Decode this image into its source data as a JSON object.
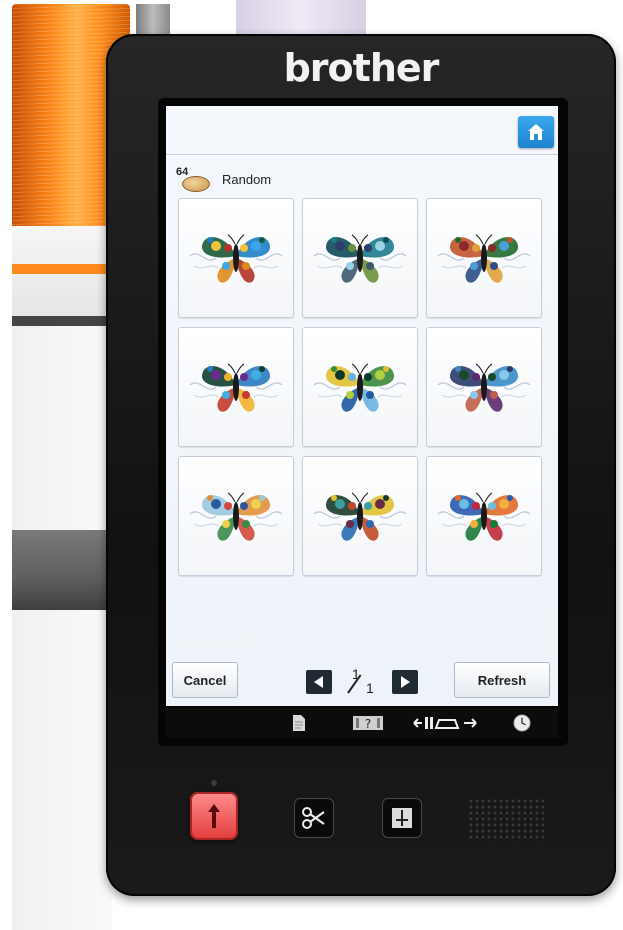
{
  "device": {
    "brand": "brother"
  },
  "screen": {
    "header": {
      "home_button_icon": "home-icon"
    },
    "pattern_count": "64",
    "mode_label": "Random",
    "thumbnails": [
      {
        "label": "",
        "palette": [
          "#1a5a3a",
          "#1e7fc4",
          "#e08a1c",
          "#b0322a",
          "#f2c23a",
          "#3aa7ec"
        ]
      },
      {
        "label": "",
        "palette": [
          "#0e4a5a",
          "#1b7a8a",
          "#3c5a6a",
          "#6b8f3a",
          "#2b3f6a",
          "#9bd2e6"
        ]
      },
      {
        "label": "",
        "palette": [
          "#c0542a",
          "#1f6a2f",
          "#2b4f8a",
          "#e0a03a",
          "#8a2a2a",
          "#4aa0d6"
        ]
      },
      {
        "label": "",
        "palette": [
          "#0f3f2f",
          "#2a7ac0",
          "#c23a2a",
          "#f0b030",
          "#6b2a8a",
          "#3cb0e0"
        ]
      },
      {
        "label": "",
        "palette": [
          "#e0c030",
          "#3a8a3a",
          "#1e5aa0",
          "#6ab0e0",
          "#0a3a2a",
          "#b0d040"
        ]
      },
      {
        "label": "",
        "palette": [
          "#2a3a6a",
          "#3a8ac8",
          "#c0604a",
          "#5a2a6a",
          "#1a4a2a",
          "#8ac8e8"
        ]
      },
      {
        "label": "",
        "palette": [
          "#9ac8e0",
          "#e0903a",
          "#3a8a4a",
          "#d04a3a",
          "#2a5a9a",
          "#f0d050"
        ]
      },
      {
        "label": "",
        "palette": [
          "#1a3a2a",
          "#e0c030",
          "#2a6ab0",
          "#c04a2a",
          "#3aa0a0",
          "#6a2a4a"
        ]
      },
      {
        "label": "",
        "palette": [
          "#2a5ab0",
          "#e06a2a",
          "#1a7a3a",
          "#c02a3a",
          "#6ac0e0",
          "#f0b040"
        ]
      }
    ],
    "footer": {
      "cancel_label": "Cancel",
      "refresh_label": "Refresh",
      "prev_icon": "triangle-left-icon",
      "next_icon": "triangle-right-icon",
      "page_current": "1",
      "page_total": "1"
    },
    "statusbar": {
      "icons": [
        "document-icon",
        "help-icon",
        "presser-foot-icon",
        "clock-icon"
      ]
    }
  },
  "hardware_buttons": [
    "start-stop-icon",
    "scissors-icon",
    "needle-position-icon"
  ],
  "colors": {
    "accent": "#1c83cf",
    "start_button": "#e23b3b",
    "nav_button": "#1f2a33"
  }
}
